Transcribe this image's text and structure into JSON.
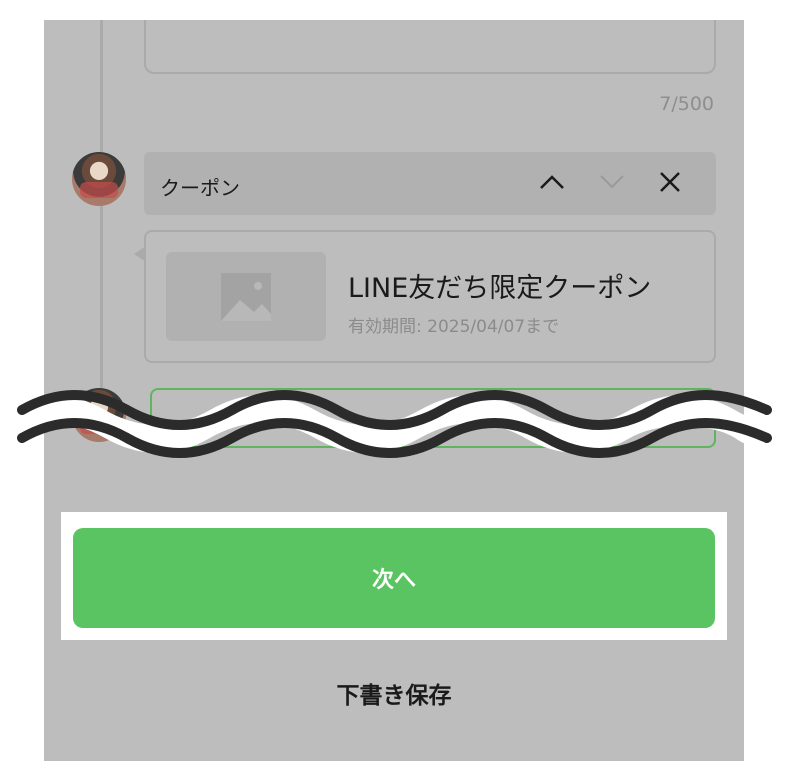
{
  "editor": {
    "char_counter": "7/500"
  },
  "message_block": {
    "type_label": "クーポン",
    "controls": [
      "chevron-up-icon",
      "chevron-down-icon",
      "close-icon"
    ]
  },
  "coupon": {
    "title": "LINE友だち限定クーポン",
    "expiry": "有効期間: 2025/04/07まで"
  },
  "actions": {
    "next_label": "次へ",
    "save_draft_label": "下書き保存"
  },
  "colors": {
    "overlay_gray": "#bdbdbd",
    "accent_green": "#5bc462",
    "text_dark": "#1a1a1a"
  }
}
